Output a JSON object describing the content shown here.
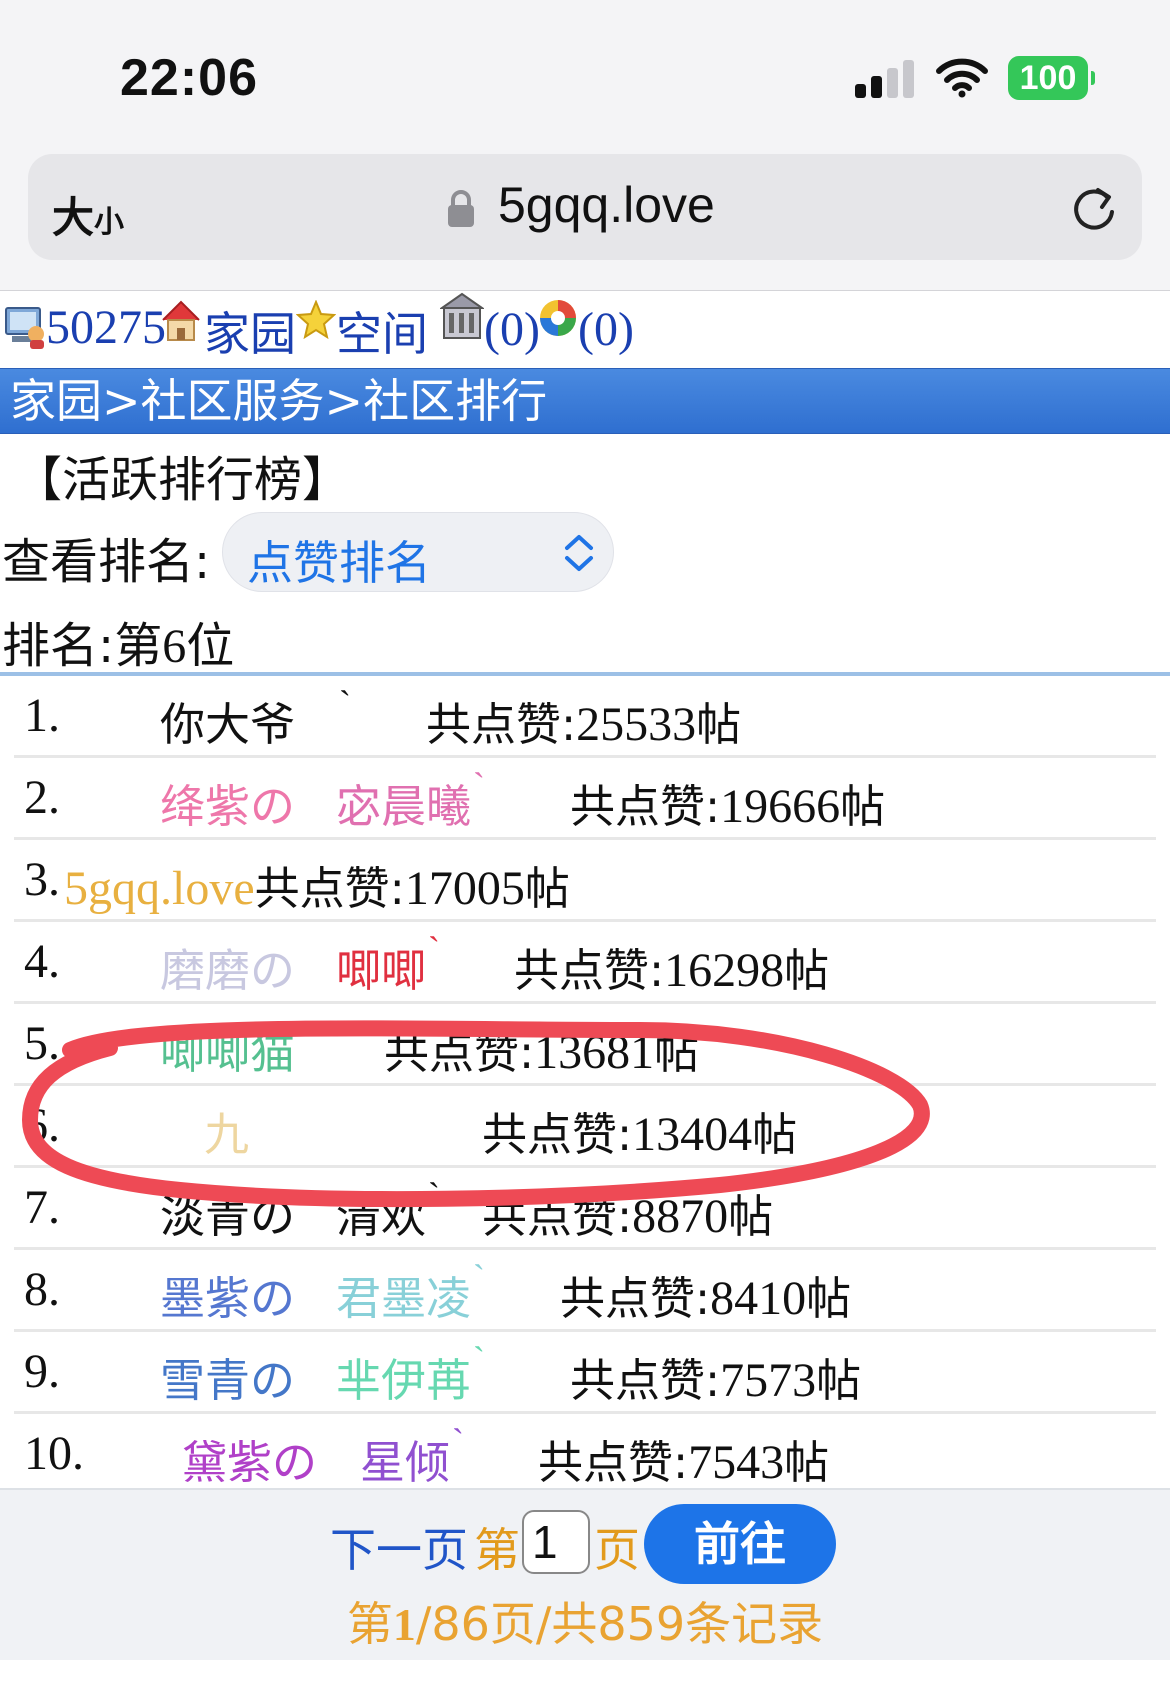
{
  "status_bar": {
    "time": "22:06",
    "battery": "100"
  },
  "browser": {
    "text_size": "大",
    "text_size_small": "小",
    "url": "5gqq.love"
  },
  "header": {
    "user_id": "50275",
    "home": "家园",
    "space": "空间",
    "messages": "(0)",
    "notices": "(0)"
  },
  "breadcrumb": "家园>社区服务>社区排行",
  "page_heading": "【活跃排行榜】",
  "view": {
    "label": "查看排名:",
    "selected": "点赞排名"
  },
  "my_rank": {
    "label": "排名:",
    "prefix": "第",
    "value": "6",
    "suffix": "位"
  },
  "likes_label": "共点赞:",
  "post_unit": "帖",
  "rankings": [
    {
      "rank": "1.",
      "name1": "你大爷",
      "name2": "",
      "mark": "ˋ",
      "likes": "25533",
      "c1": "#111111",
      "c2": "#111111"
    },
    {
      "rank": "2.",
      "name1": "绛紫の",
      "name2": "宓晨曦",
      "mark": "ˋ",
      "likes": "19666",
      "c1": "#ee77aa",
      "c2": "#e070b0"
    },
    {
      "rank": "3.",
      "name1": "5gqq.love",
      "name2": "",
      "mark": "",
      "likes": "17005",
      "c1": "#e8b040",
      "c2": "#c070d0"
    },
    {
      "rank": "4.",
      "name1": "磨磨の",
      "name2": "唧唧",
      "mark": "ˋ",
      "likes": "16298",
      "c1": "#c8c8e0",
      "c2": "#e03040"
    },
    {
      "rank": "5.",
      "name1": "唧唧猫",
      "name2": "",
      "mark": "",
      "likes": "13681",
      "c1": "#55c090",
      "c2": "#55c090"
    },
    {
      "rank": "6.",
      "name1": "九",
      "name2": "",
      "mark": "",
      "likes": "13404",
      "c1": "#eed6a0",
      "c2": "#eed6a0"
    },
    {
      "rank": "7.",
      "name1": "淡青の",
      "name2": "清欢",
      "mark": "ˋ",
      "likes": "8870",
      "c1": "#111111",
      "c2": "#111111"
    },
    {
      "rank": "8.",
      "name1": "墨紫の",
      "name2": "君墨凌",
      "mark": "ˋ",
      "likes": "8410",
      "c1": "#5577d0",
      "c2": "#88d0d8"
    },
    {
      "rank": "9.",
      "name1": "雪青の",
      "name2": "芈伊苒",
      "mark": "ˋ",
      "likes": "7573",
      "c1": "#4477c8",
      "c2": "#66d8b0"
    },
    {
      "rank": "10.",
      "name1": "黛紫の",
      "name2": "星倾",
      "mark": "ˋ",
      "likes": "7543",
      "c1": "#b040c8",
      "c2": "#9050d0"
    }
  ],
  "pagination": {
    "next": "下一页",
    "page_prefix": "第",
    "page_value": "1",
    "page_suffix": "页",
    "go": "前往",
    "summary_prefix": "第",
    "summary_current": "1",
    "summary_rest": "/86页/共859条记录"
  },
  "colors": {
    "accent": "#1d74e8",
    "breadcrumb": "#3a7bd8",
    "annotation": "#ee4a55"
  }
}
